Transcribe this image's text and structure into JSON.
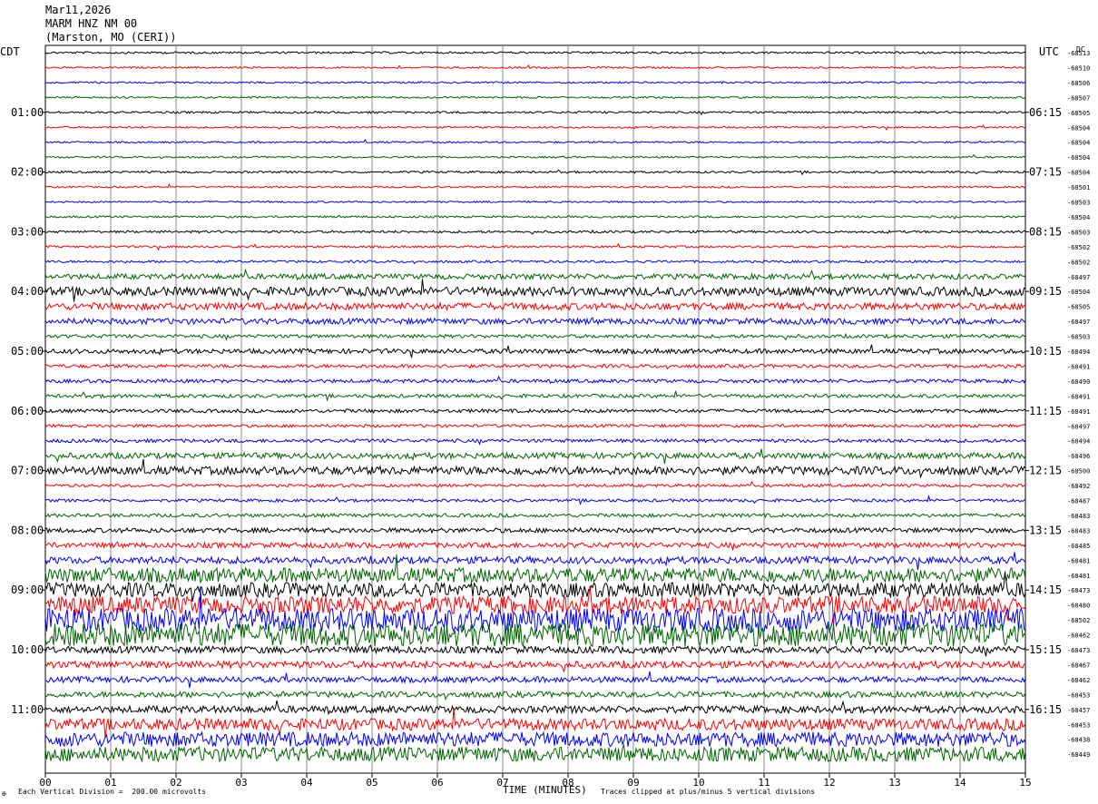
{
  "header": {
    "date": "Mar11,2026",
    "station": "MARM HNZ NM 00",
    "location": "(Marston, MO (CERI))"
  },
  "left_axis_title": "CDT",
  "right_axis_title": "UTC",
  "dc_label": "DC",
  "footer": {
    "scale_note": "Each Vertical Division =  200.00 microvolts",
    "clip_note": "Traces clipped at plus/minus 5 vertical divisions",
    "corner_mark": "✠"
  },
  "colors": {
    "trace_cycle": [
      "#000000",
      "#ff0000",
      "#0000ff",
      "#006400"
    ],
    "grid": "#888888"
  },
  "chart_data": {
    "type": "line",
    "title": "MARM HNZ NM 00",
    "xlabel": "TIME (MINUTES)",
    "ylabel": "",
    "x_ticks": [
      "00",
      "01",
      "02",
      "03",
      "04",
      "05",
      "06",
      "07",
      "08",
      "09",
      "10",
      "11",
      "12",
      "13",
      "14",
      "15"
    ],
    "xlim": [
      0,
      15
    ],
    "minutes_per_trace": 15,
    "cdt_labels": [
      "01:00",
      "02:00",
      "03:00",
      "04:00",
      "05:00",
      "06:00",
      "07:00",
      "08:00",
      "09:00",
      "10:00",
      "11:00"
    ],
    "utc_labels": [
      "06:15",
      "07:15",
      "08:15",
      "09:15",
      "10:15",
      "11:15",
      "12:15",
      "13:15",
      "14:15",
      "15:15",
      "16:15"
    ],
    "dc_offsets": [
      -68513,
      -68510,
      -68506,
      -68507,
      -68505,
      -68504,
      -68504,
      -68504,
      -68504,
      -68501,
      -68503,
      -68504,
      -68503,
      -68502,
      -68502,
      -68497,
      -68504,
      -68505,
      -68497,
      -68503,
      -68494,
      -68491,
      -68490,
      -68491,
      -68491,
      -68497,
      -68494,
      -68496,
      -68500,
      -68492,
      -68487,
      -68483,
      -68483,
      -68485,
      -68481,
      -68481,
      -68473,
      -68480,
      -68502,
      -68462,
      -68473,
      -68467,
      -68462,
      -68453,
      -68457,
      -68453,
      -68438,
      -68449
    ],
    "trace_amplitude_level": [
      0.35,
      0.3,
      0.3,
      0.3,
      0.35,
      0.3,
      0.3,
      0.3,
      0.35,
      0.3,
      0.3,
      0.35,
      0.4,
      0.35,
      0.4,
      0.9,
      1.5,
      1.2,
      1.0,
      0.6,
      0.8,
      0.6,
      0.6,
      0.6,
      0.6,
      0.5,
      0.6,
      1.0,
      1.4,
      0.5,
      0.5,
      0.6,
      0.8,
      0.9,
      1.2,
      2.5,
      2.5,
      3.0,
      4.0,
      4.0,
      1.2,
      1.2,
      1.0,
      1.0,
      1.2,
      2.0,
      2.5,
      2.5
    ],
    "series": [
      {
        "name": "MARM HNZ NM 00",
        "values": []
      }
    ]
  }
}
